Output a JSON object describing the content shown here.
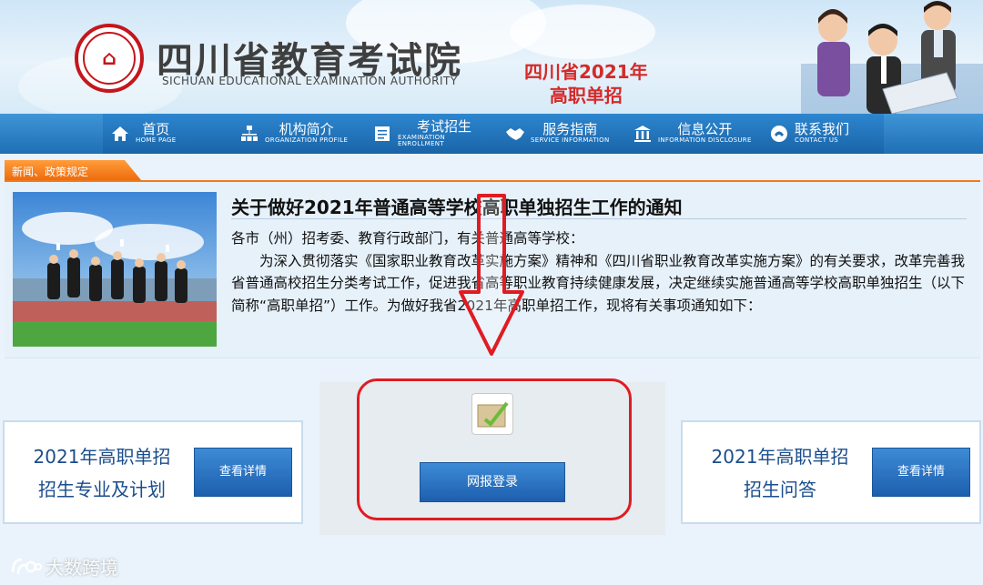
{
  "header": {
    "org_name_cn": "四川省教育考试院",
    "org_name_en": "SICHUAN EDUCATIONAL EXAMINATION AUTHORITY",
    "slogan_line1": "四川省2021年",
    "slogan_line2": "高职单招"
  },
  "nav": {
    "items": [
      {
        "cn": "首页",
        "en": "HOME PAGE",
        "icon": "home-icon"
      },
      {
        "cn": "机构简介",
        "en": "ORGANIZATION PROFILE",
        "icon": "org-chart-icon"
      },
      {
        "cn": "考试招生",
        "en": "EXAMINATION ENROLLMENT",
        "icon": "document-icon"
      },
      {
        "cn": "服务指南",
        "en": "SERVICE INFORMATION",
        "icon": "handshake-icon"
      },
      {
        "cn": "信息公开",
        "en": "INFORMATION DISCLOSURE",
        "icon": "info-building-icon"
      },
      {
        "cn": "联系我们",
        "en": "CONTACT US",
        "icon": "phone-icon"
      }
    ]
  },
  "news": {
    "tab_label": "新闻、政策规定",
    "title": "关于做好2021年普通高等学校高职单独招生工作的通知",
    "greeting": "各市（州）招考委、教育行政部门，有关普通高等学校：",
    "body": "为深入贯彻落实《国家职业教育改革实施方案》精神和《四川省职业教育改革实施方案》的有关要求，改革完善我省普通高校招生分类考试工作，促进我省高等职业教育持续健康发展，决定继续实施普通高等学校高职单独招生（以下简称“高职单招”）工作。为做好我省2021年高职单招工作，现将有关事项通知如下："
  },
  "cards": {
    "left": {
      "line1": "2021年高职单招",
      "line2": "招生专业及计划",
      "button": "查看详情"
    },
    "center": {
      "button": "网报登录",
      "icon": "edit-icon"
    },
    "right": {
      "line1": "2021年高职单招",
      "line2": "招生问答",
      "button": "查看详情"
    }
  },
  "watermark": {
    "text": "大数跨境"
  },
  "colors": {
    "nav_blue": "#1f6fb5",
    "accent_orange": "#ef6b0c",
    "annotation_red": "#e11b22",
    "card_text": "#1a4d8c"
  }
}
